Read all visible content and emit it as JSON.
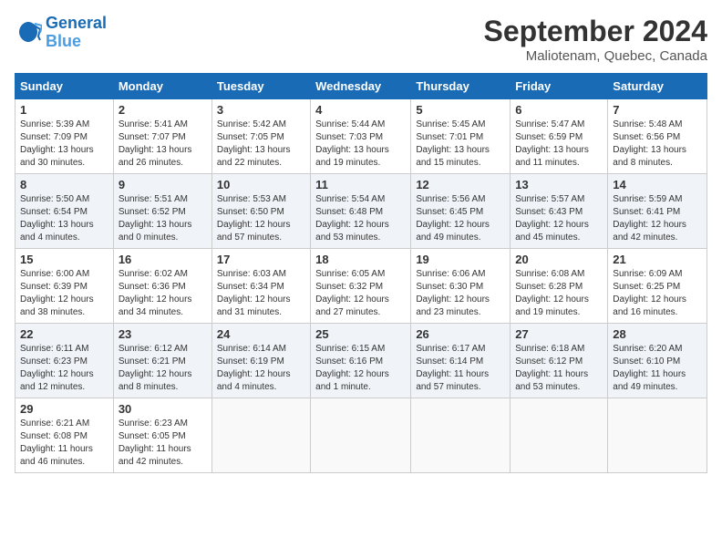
{
  "logo": {
    "line1": "General",
    "line2": "Blue"
  },
  "title": "September 2024",
  "subtitle": "Maliotenam, Quebec, Canada",
  "weekdays": [
    "Sunday",
    "Monday",
    "Tuesday",
    "Wednesday",
    "Thursday",
    "Friday",
    "Saturday"
  ],
  "weeks": [
    [
      {
        "day": "1",
        "info": "Sunrise: 5:39 AM\nSunset: 7:09 PM\nDaylight: 13 hours\nand 30 minutes."
      },
      {
        "day": "2",
        "info": "Sunrise: 5:41 AM\nSunset: 7:07 PM\nDaylight: 13 hours\nand 26 minutes."
      },
      {
        "day": "3",
        "info": "Sunrise: 5:42 AM\nSunset: 7:05 PM\nDaylight: 13 hours\nand 22 minutes."
      },
      {
        "day": "4",
        "info": "Sunrise: 5:44 AM\nSunset: 7:03 PM\nDaylight: 13 hours\nand 19 minutes."
      },
      {
        "day": "5",
        "info": "Sunrise: 5:45 AM\nSunset: 7:01 PM\nDaylight: 13 hours\nand 15 minutes."
      },
      {
        "day": "6",
        "info": "Sunrise: 5:47 AM\nSunset: 6:59 PM\nDaylight: 13 hours\nand 11 minutes."
      },
      {
        "day": "7",
        "info": "Sunrise: 5:48 AM\nSunset: 6:56 PM\nDaylight: 13 hours\nand 8 minutes."
      }
    ],
    [
      {
        "day": "8",
        "info": "Sunrise: 5:50 AM\nSunset: 6:54 PM\nDaylight: 13 hours\nand 4 minutes."
      },
      {
        "day": "9",
        "info": "Sunrise: 5:51 AM\nSunset: 6:52 PM\nDaylight: 13 hours\nand 0 minutes."
      },
      {
        "day": "10",
        "info": "Sunrise: 5:53 AM\nSunset: 6:50 PM\nDaylight: 12 hours\nand 57 minutes."
      },
      {
        "day": "11",
        "info": "Sunrise: 5:54 AM\nSunset: 6:48 PM\nDaylight: 12 hours\nand 53 minutes."
      },
      {
        "day": "12",
        "info": "Sunrise: 5:56 AM\nSunset: 6:45 PM\nDaylight: 12 hours\nand 49 minutes."
      },
      {
        "day": "13",
        "info": "Sunrise: 5:57 AM\nSunset: 6:43 PM\nDaylight: 12 hours\nand 45 minutes."
      },
      {
        "day": "14",
        "info": "Sunrise: 5:59 AM\nSunset: 6:41 PM\nDaylight: 12 hours\nand 42 minutes."
      }
    ],
    [
      {
        "day": "15",
        "info": "Sunrise: 6:00 AM\nSunset: 6:39 PM\nDaylight: 12 hours\nand 38 minutes."
      },
      {
        "day": "16",
        "info": "Sunrise: 6:02 AM\nSunset: 6:36 PM\nDaylight: 12 hours\nand 34 minutes."
      },
      {
        "day": "17",
        "info": "Sunrise: 6:03 AM\nSunset: 6:34 PM\nDaylight: 12 hours\nand 31 minutes."
      },
      {
        "day": "18",
        "info": "Sunrise: 6:05 AM\nSunset: 6:32 PM\nDaylight: 12 hours\nand 27 minutes."
      },
      {
        "day": "19",
        "info": "Sunrise: 6:06 AM\nSunset: 6:30 PM\nDaylight: 12 hours\nand 23 minutes."
      },
      {
        "day": "20",
        "info": "Sunrise: 6:08 AM\nSunset: 6:28 PM\nDaylight: 12 hours\nand 19 minutes."
      },
      {
        "day": "21",
        "info": "Sunrise: 6:09 AM\nSunset: 6:25 PM\nDaylight: 12 hours\nand 16 minutes."
      }
    ],
    [
      {
        "day": "22",
        "info": "Sunrise: 6:11 AM\nSunset: 6:23 PM\nDaylight: 12 hours\nand 12 minutes."
      },
      {
        "day": "23",
        "info": "Sunrise: 6:12 AM\nSunset: 6:21 PM\nDaylight: 12 hours\nand 8 minutes."
      },
      {
        "day": "24",
        "info": "Sunrise: 6:14 AM\nSunset: 6:19 PM\nDaylight: 12 hours\nand 4 minutes."
      },
      {
        "day": "25",
        "info": "Sunrise: 6:15 AM\nSunset: 6:16 PM\nDaylight: 12 hours\nand 1 minute."
      },
      {
        "day": "26",
        "info": "Sunrise: 6:17 AM\nSunset: 6:14 PM\nDaylight: 11 hours\nand 57 minutes."
      },
      {
        "day": "27",
        "info": "Sunrise: 6:18 AM\nSunset: 6:12 PM\nDaylight: 11 hours\nand 53 minutes."
      },
      {
        "day": "28",
        "info": "Sunrise: 6:20 AM\nSunset: 6:10 PM\nDaylight: 11 hours\nand 49 minutes."
      }
    ],
    [
      {
        "day": "29",
        "info": "Sunrise: 6:21 AM\nSunset: 6:08 PM\nDaylight: 11 hours\nand 46 minutes."
      },
      {
        "day": "30",
        "info": "Sunrise: 6:23 AM\nSunset: 6:05 PM\nDaylight: 11 hours\nand 42 minutes."
      },
      {
        "day": "",
        "info": ""
      },
      {
        "day": "",
        "info": ""
      },
      {
        "day": "",
        "info": ""
      },
      {
        "day": "",
        "info": ""
      },
      {
        "day": "",
        "info": ""
      }
    ]
  ]
}
